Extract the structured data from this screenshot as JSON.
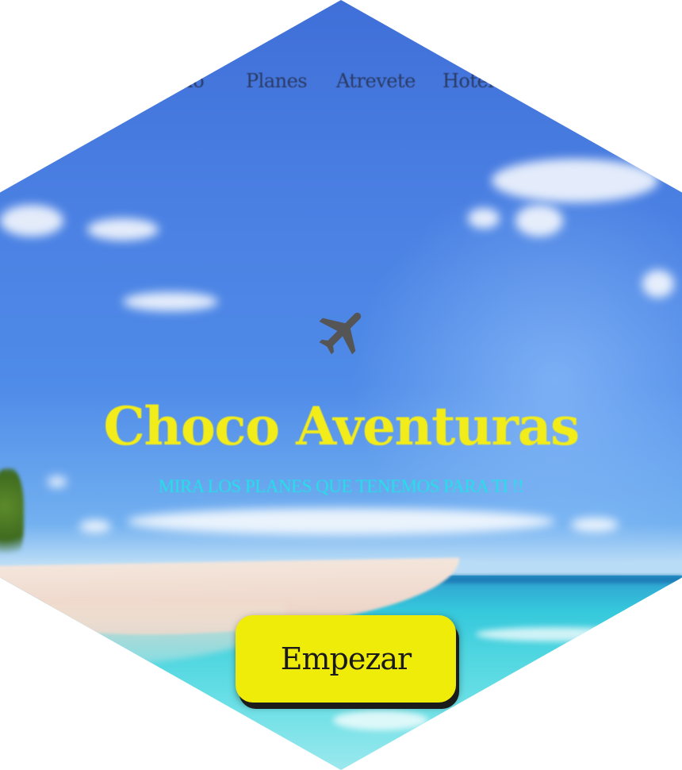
{
  "nav": {
    "items": [
      {
        "label": "Inicio"
      },
      {
        "label": "Planes"
      },
      {
        "label": "Atrevete"
      },
      {
        "label": "Hoteles"
      }
    ]
  },
  "hero": {
    "icon": "airplane-icon",
    "title": "Choco Aventuras",
    "subtitle": "MIRA LOS PLANES QUE TENEMOS PARA TI !!",
    "cta_label": "Empezar"
  },
  "colors": {
    "title": "#f2ec1a",
    "subtitle": "#22e2e8",
    "button": "#f0ec0a",
    "nav_text": "#2b3a63",
    "sky": "#4a7fe2"
  }
}
